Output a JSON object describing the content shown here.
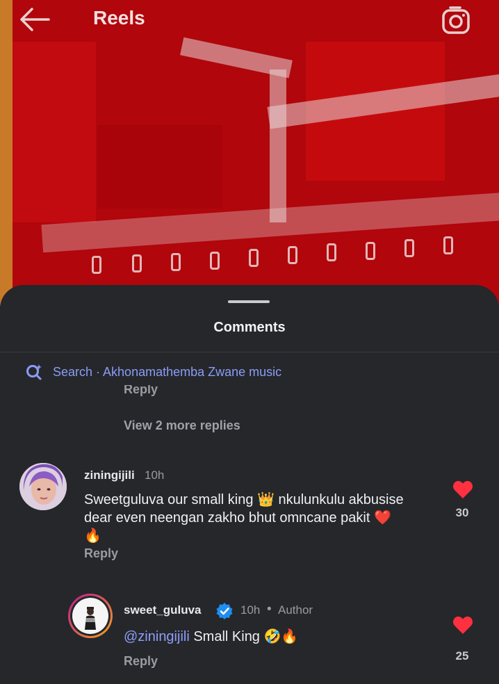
{
  "header": {
    "title": "Reels",
    "back_icon": "arrow-left-icon",
    "camera_icon": "camera-icon"
  },
  "sheet": {
    "title": "Comments",
    "search_text": "Search · Akhonamathemba Zwane music",
    "partial_reply": "Reply",
    "view_more": "View 2 more replies"
  },
  "comments": [
    {
      "username": "ziningijili",
      "time": "10h",
      "text": "Sweetguluva our small king 👑 nkulunkulu akbusise dear even neengan zakho bhut omncane pakit ❤️🔥",
      "reply": "Reply",
      "likes": "30"
    },
    {
      "username": "sweet_guluva",
      "verified": true,
      "time": "10h",
      "author_tag": "Author",
      "mention": "@ziningijili",
      "text": " Small King 🤣🔥",
      "reply": "Reply",
      "likes": "25"
    }
  ],
  "colors": {
    "sheet_bg": "#25272b",
    "accent_link": "#8b9cf7",
    "heart": "#ff3040",
    "video_red": "#b0060c"
  }
}
